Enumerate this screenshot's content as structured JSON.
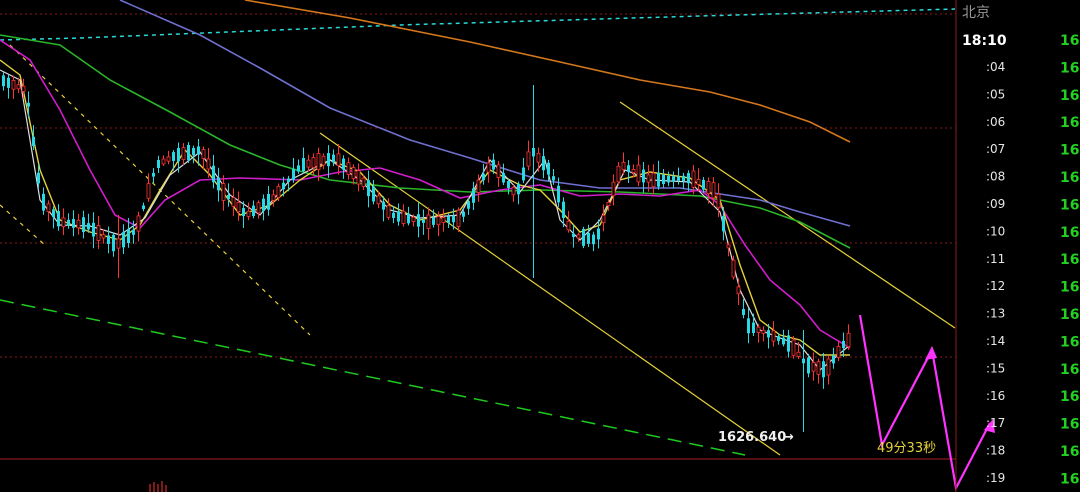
{
  "colors": {
    "background": "#000000",
    "up_candle": "#ff3333",
    "down_candle": "#26d9e6",
    "ma_fast": "#e6d23a",
    "ma_mid": "#d01ecb",
    "ma_green": "#2ab52a",
    "ma_blue": "#7070d0",
    "ma_orange": "#d5781c",
    "ma_white": "#dddddd",
    "trend_line": "#e6d23a",
    "dashed_cyan": "#2bd8d8",
    "dashed_green": "#1ecb1e",
    "projection": "#ff33ff",
    "grid": "#8b1a1a",
    "right_axis_text": "#23d123"
  },
  "header": {
    "region": "北京",
    "current_time": "18:10"
  },
  "axis": {
    "time_labels": [
      ":04",
      ":05",
      ":06",
      ":07",
      ":08",
      ":09",
      ":10",
      ":11",
      ":12",
      ":13",
      ":14",
      ":15",
      ":16",
      ":17",
      ":18",
      ":19"
    ],
    "right_values": [
      "16",
      "16",
      "16",
      "16",
      "16",
      "16",
      "16",
      "16",
      "16",
      "16",
      "16",
      "16",
      "16",
      "16",
      "16",
      "16",
      "16"
    ]
  },
  "annotations": {
    "low_price": "1626.640",
    "countdown": "49分33秒"
  },
  "chart_data": {
    "type": "candlestick",
    "timeframe_labels": [
      ":04",
      ":05",
      ":06",
      ":07",
      ":08",
      ":09",
      ":10",
      ":11",
      ":12",
      ":13",
      ":14",
      ":15",
      ":16",
      ":17",
      ":18",
      ":19"
    ],
    "price_annotation": 1626.64,
    "countdown": "49分33秒",
    "grid": true,
    "series": [
      {
        "kind": "candles",
        "trend": "descending"
      },
      {
        "kind": "moving_average",
        "color": "#e6d23a"
      },
      {
        "kind": "moving_average",
        "color": "#d01ecb"
      },
      {
        "kind": "moving_average",
        "color": "#2ab52a"
      },
      {
        "kind": "moving_average",
        "color": "#7070d0"
      },
      {
        "kind": "moving_average",
        "color": "#d5781c"
      }
    ]
  }
}
